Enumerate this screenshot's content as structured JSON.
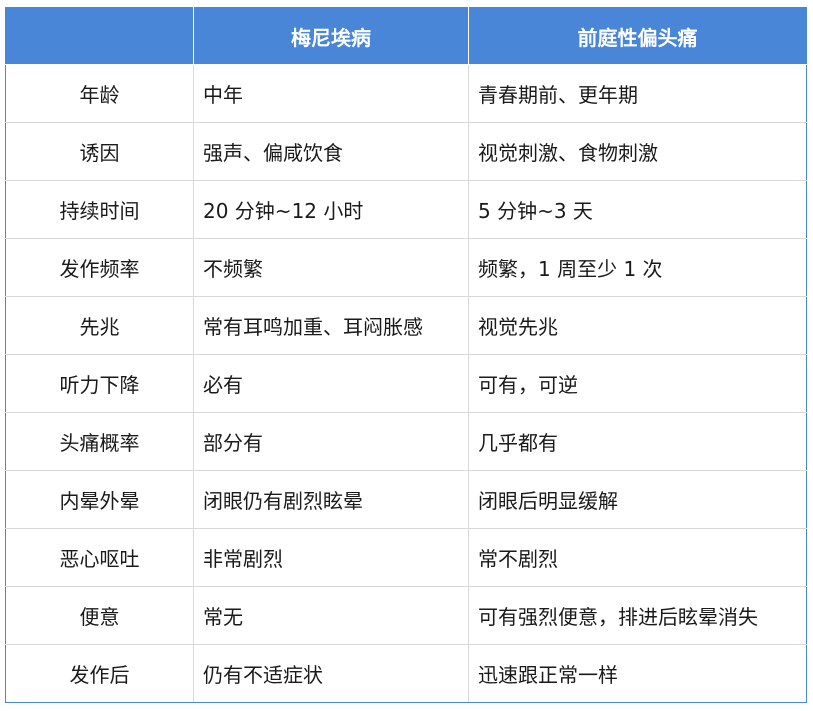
{
  "table": {
    "headers": [
      "",
      "梅尼埃病",
      "前庭性偏头痛"
    ],
    "rows": [
      {
        "label": "年龄",
        "col1": "中年",
        "col2": "青春期前、更年期"
      },
      {
        "label": "诱因",
        "col1": "强声、偏咸饮食",
        "col2": "视觉刺激、食物刺激"
      },
      {
        "label": "持续时间",
        "col1": "20 分钟~12 小时",
        "col2": "5 分钟~3 天"
      },
      {
        "label": "发作频率",
        "col1": "不频繁",
        "col2": "频繁，1 周至少 1 次"
      },
      {
        "label": "先兆",
        "col1": "常有耳鸣加重、耳闷胀感",
        "col2": "视觉先兆"
      },
      {
        "label": "听力下降",
        "col1": "必有",
        "col2": "可有，可逆"
      },
      {
        "label": "头痛概率",
        "col1": "部分有",
        "col2": "几乎都有"
      },
      {
        "label": "内晕外晕",
        "col1": "闭眼仍有剧烈眩晕",
        "col2": "闭眼后明显缓解"
      },
      {
        "label": "恶心呕吐",
        "col1": "非常剧烈",
        "col2": "常不剧烈"
      },
      {
        "label": "便意",
        "col1": "常无",
        "col2": "可有强烈便意，排进后眩晕消失"
      },
      {
        "label": "发作后",
        "col1": "仍有不适症状",
        "col2": "迅速跟正常一样"
      }
    ]
  },
  "colors": {
    "header_bg": "#4a86d8",
    "header_text": "#ffffff",
    "border": "#d9d9d9",
    "text": "#1a1a1a"
  }
}
